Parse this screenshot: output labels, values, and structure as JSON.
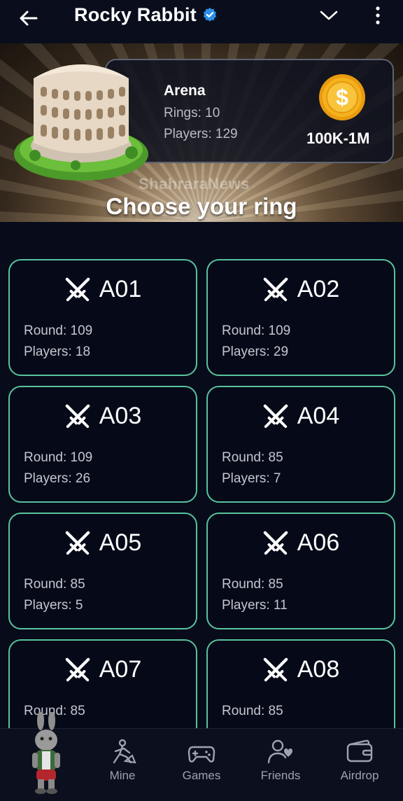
{
  "header": {
    "title": "Rocky Rabbit",
    "icons": [
      "back-arrow-icon",
      "verified-badge-icon",
      "chevron-down-icon",
      "more-vertical-icon"
    ]
  },
  "arena": {
    "name": "Arena",
    "rings": "Rings: 10",
    "players": "Players: 129",
    "price_range": "100K-1M",
    "watermark": "ShahraraNews",
    "heading": "Choose your ring"
  },
  "rings": [
    {
      "code": "A01",
      "round": "Round: 109",
      "players": "Players: 18"
    },
    {
      "code": "A02",
      "round": "Round: 109",
      "players": "Players: 29"
    },
    {
      "code": "A03",
      "round": "Round: 109",
      "players": "Players: 26"
    },
    {
      "code": "A04",
      "round": "Round: 85",
      "players": "Players: 7"
    },
    {
      "code": "A05",
      "round": "Round: 85",
      "players": "Players: 5"
    },
    {
      "code": "A06",
      "round": "Round: 85",
      "players": "Players: 11"
    },
    {
      "code": "A07",
      "round": "Round: 85",
      "players": ""
    },
    {
      "code": "A08",
      "round": "Round: 85",
      "players": ""
    }
  ],
  "nav": {
    "items": [
      {
        "label": "Mine",
        "icon": "mine-icon"
      },
      {
        "label": "Games",
        "icon": "gamepad-icon"
      },
      {
        "label": "Friends",
        "icon": "friends-icon"
      },
      {
        "label": "Airdrop",
        "icon": "wallet-icon"
      }
    ]
  },
  "colors": {
    "background": "#070b1a",
    "card_border": "#58c39c",
    "verified": "#2d8ee8",
    "coin": "#f5b21c",
    "muted_text": "#c4c7cf"
  }
}
